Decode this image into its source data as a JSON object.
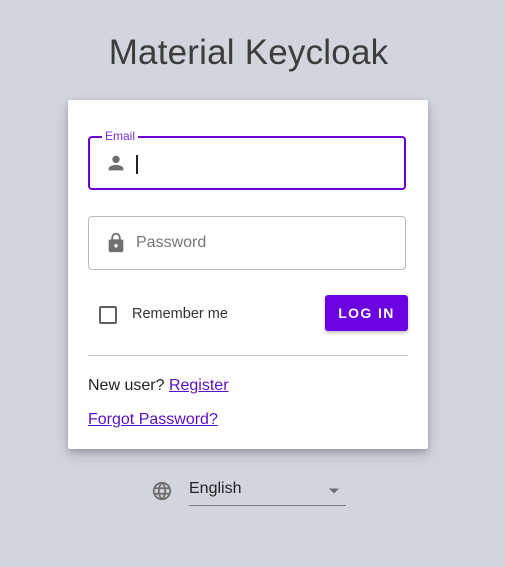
{
  "page": {
    "title": "Material Keycloak"
  },
  "login_form": {
    "email": {
      "label": "Email",
      "value": ""
    },
    "password": {
      "placeholder": "Password",
      "value": ""
    },
    "remember_me": {
      "label": "Remember me",
      "checked": false
    },
    "login_button_label": "LOG IN",
    "new_user_text": "New user?",
    "register_link": "Register",
    "forgot_password_link": "Forgot Password?"
  },
  "locale": {
    "selected": "English"
  },
  "icons": {
    "email_field": "person-icon",
    "password_field": "lock-icon",
    "locale": "globe-icon",
    "locale_dropdown": "arrow-drop-down-icon"
  },
  "colors": {
    "background": "#d2d4de",
    "accent": "#6b02e2",
    "focus_border": "#6b02d1",
    "link": "#5a0fc8"
  }
}
